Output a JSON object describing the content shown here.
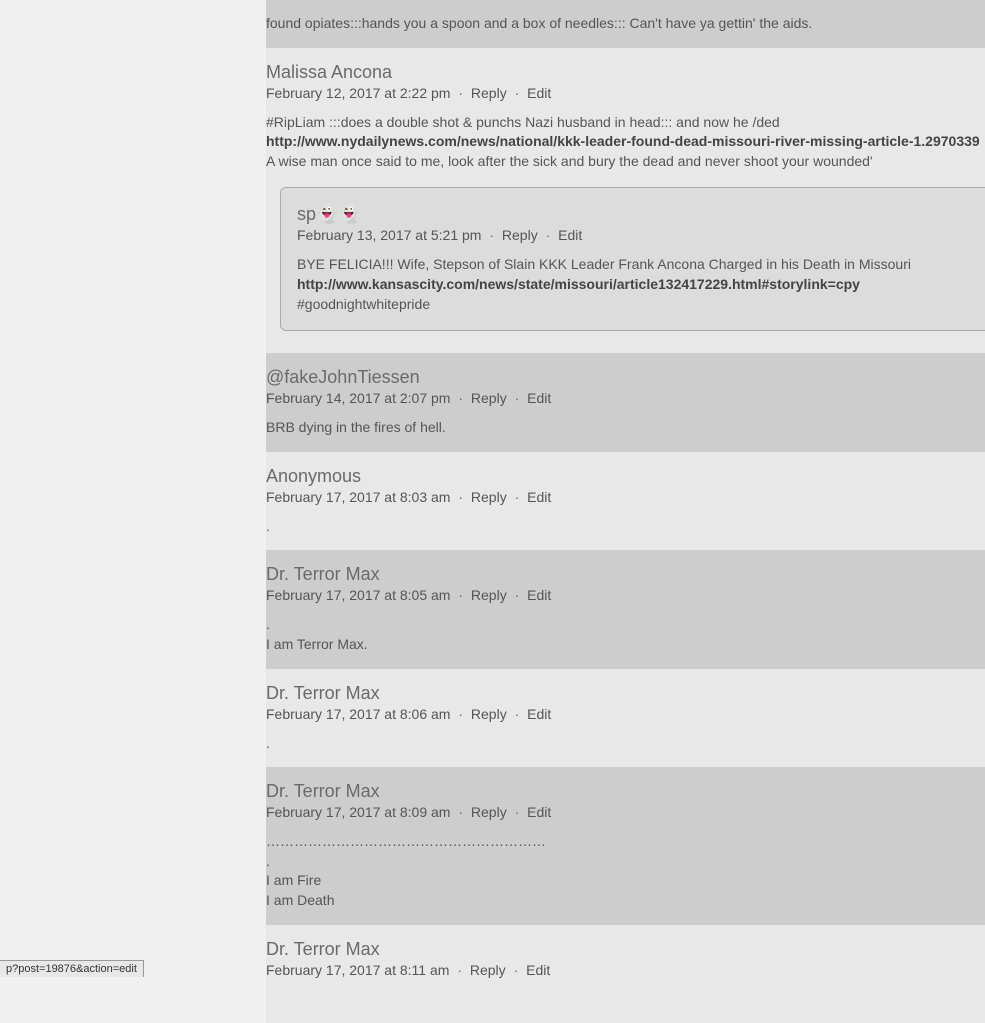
{
  "actions": {
    "reply": "Reply",
    "edit": "Edit",
    "sep": "·"
  },
  "comments": [
    {
      "author": "",
      "meta": "",
      "body_text": "found opiates:::hands you a spoon and a box of needles::: Can't have ya gettin' the aids.",
      "even": true
    },
    {
      "author": "Malissa Ancona",
      "meta": "February 12, 2017 at 2:22 pm",
      "body_pre": "#RipLiam :::does a double shot & punchs Nazi husband in head::: and now he /ded",
      "link": "http://www.nydailynews.com/news/national/kkk-leader-found-dead-missouri-river-missing-article-1.2970339",
      "body_post": "A wise man once said to me, look after the sick and bury the dead and never shoot your wounded'",
      "even": false,
      "nested": {
        "author": "sp👻👻",
        "meta": "February 13, 2017 at 5:21 pm",
        "body_pre": "BYE FELICIA!!! Wife, Stepson of Slain KKK Leader Frank Ancona Charged in his Death in Missouri",
        "link": "http://www.kansascity.com/news/state/missouri/article132417229.html#storylink=cpy",
        "body_post": "#goodnightwhitepride"
      }
    },
    {
      "author": "@fakeJohnTiessen",
      "meta": "February 14, 2017 at 2:07 pm",
      "body_text": "BRB dying in the fires of hell.",
      "even": true
    },
    {
      "author": "Anonymous",
      "meta": "February 17, 2017 at 8:03 am",
      "body_text": ".",
      "even": false
    },
    {
      "author": "Dr. Terror Max",
      "meta": "February 17, 2017 at 8:05 am",
      "body_text": ".\nI am Terror Max.",
      "even": true
    },
    {
      "author": "Dr. Terror Max",
      "meta": "February 17, 2017 at 8:06 am",
      "body_text": ".",
      "even": false
    },
    {
      "author": "Dr. Terror Max",
      "meta": "February 17, 2017 at 8:09 am",
      "body_text": "……………………………………………………\n.\nI am Fire\nI am Death",
      "even": true
    },
    {
      "author": "Dr. Terror Max",
      "meta": "February 17, 2017 at 8:11 am",
      "body_text": "",
      "even": false
    }
  ],
  "statusbar": "p?post=19876&action=edit"
}
